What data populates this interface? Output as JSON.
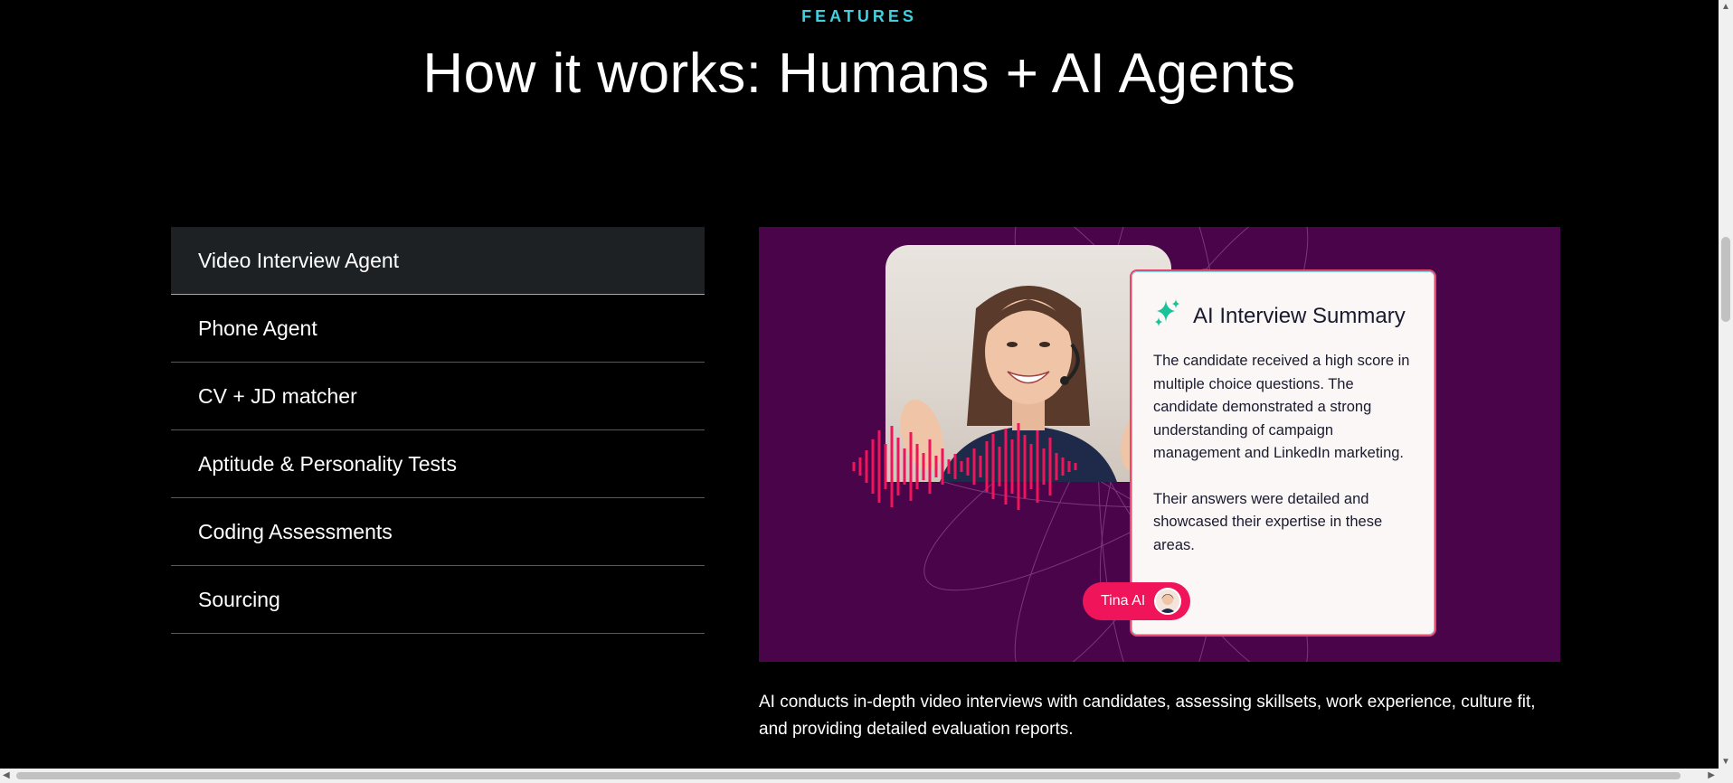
{
  "section": {
    "eyebrow": "FEATURES",
    "headline": "How it works: Humans + AI Agents"
  },
  "tabs": [
    {
      "label": "Video Interview Agent",
      "active": true
    },
    {
      "label": "Phone Agent",
      "active": false
    },
    {
      "label": "CV + JD matcher",
      "active": false
    },
    {
      "label": "Aptitude & Personality Tests",
      "active": false
    },
    {
      "label": "Coding Assessments",
      "active": false
    },
    {
      "label": "Sourcing",
      "active": false
    }
  ],
  "card": {
    "title": "AI Interview Summary",
    "paragraph1": "The candidate received a high score in multiple choice questions. The candidate demonstrated a strong understanding of campaign management and LinkedIn marketing.",
    "paragraph2": "Their answers were detailed and showcased their expertise in these areas.",
    "agent_name": "Tina AI"
  },
  "description": "AI conducts in-depth video interviews with candidates, assessing skillsets, work experience, culture fit, and providing detailed evaluation reports.",
  "colors": {
    "accent": "#3fd1e0",
    "panel_bg": "#4a0449",
    "waveform": "#f0145a",
    "sparkle": "#19c39a"
  }
}
